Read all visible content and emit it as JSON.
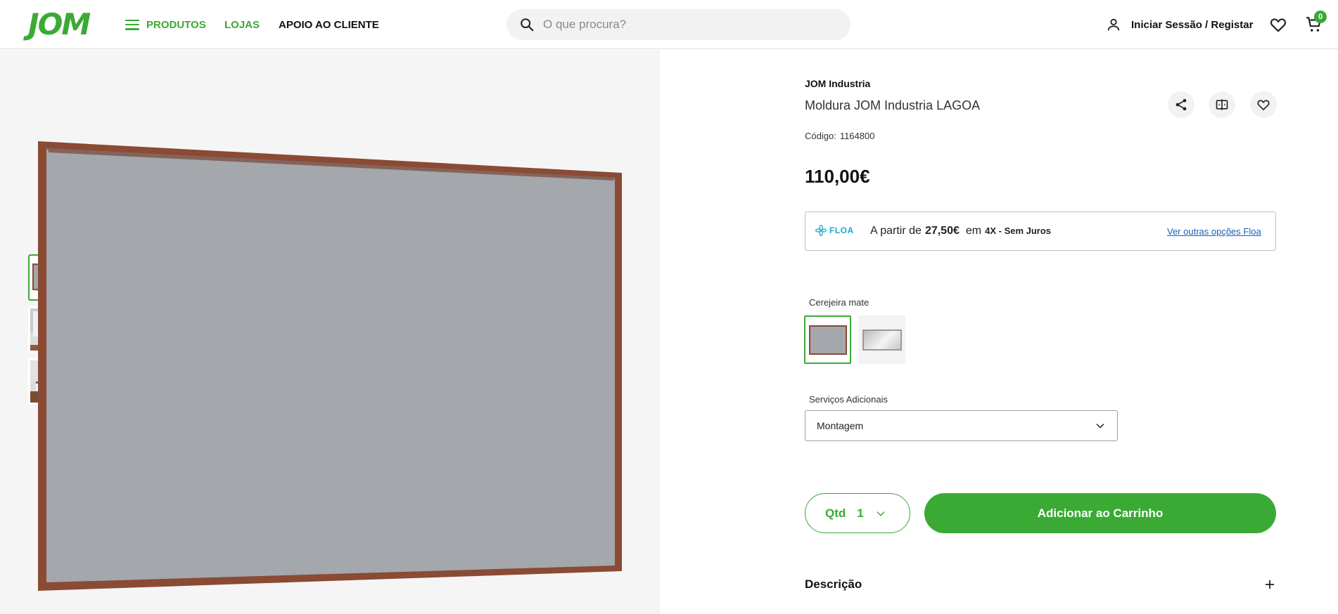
{
  "header": {
    "logo": "JOM",
    "nav": {
      "products": "PRODUTOS",
      "stores": "LOJAS",
      "support": "APOIO AO CLIENTE"
    },
    "search": {
      "placeholder": "O que procura?"
    },
    "login": "Iniciar Sessão / Registar",
    "cart_count": "0"
  },
  "gallery": {
    "thumbnails": [
      "product-front",
      "room-dresser",
      "room-bedroom"
    ],
    "active_index": 0
  },
  "product": {
    "brand": "JOM Industria",
    "name": "Moldura JOM Industria LAGOA",
    "code_label": "Código:",
    "code": "1164800",
    "price": "110,00€",
    "financing": {
      "provider": "FLOA",
      "prefix": "A partir de",
      "amount": "27,50€",
      "in": "em",
      "terms": "4X - Sem Juros",
      "link": "Ver outras opções Floa"
    },
    "variant_label": "Cerejeira mate",
    "variants": [
      "Cerejeira mate",
      "Espelho"
    ],
    "services_label": "Serviços Adicionais",
    "services_selected": "Montagem",
    "qty_label": "Qtd",
    "qty_value": "1",
    "add_to_cart": "Adicionar ao Carrinho",
    "description_label": "Descrição"
  },
  "colors": {
    "brand_green": "#3aaa35",
    "frame_wood": "#8a4a34",
    "mirror_grey": "#a4a7ab",
    "floa_blue": "#1fa6d6",
    "link_blue": "#1a5fb4"
  },
  "icons": [
    "menu-icon",
    "search-icon",
    "user-icon",
    "heart-icon",
    "cart-icon",
    "share-icon",
    "compare-icon",
    "chevron-down-icon",
    "plus-icon",
    "floa-flower-icon"
  ]
}
